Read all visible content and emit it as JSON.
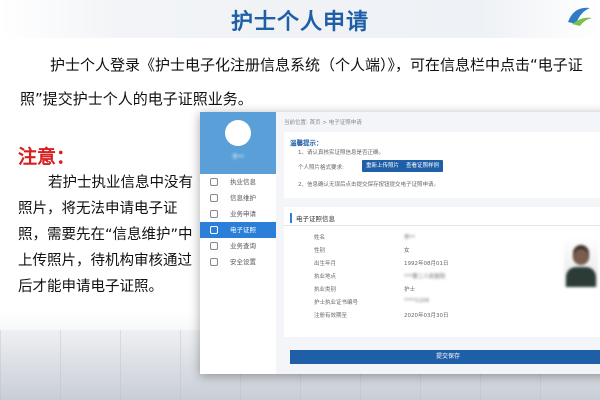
{
  "slide": {
    "title": "护士个人申请",
    "intro_line1": "护士个人登录《护士电子化注册信息系统（个人端）》，可在信息栏中点击“电子证",
    "intro_line2": "照”提交护士个人的电子证照业务。",
    "note_title": "注意：",
    "note_body": "若护士执业信息中没有照片，将无法申请电子证照，需要先在“信息维护”中上传照片，待机构审核通过后才能申请电子证照。"
  },
  "app": {
    "breadcrumb": "当前位置: 首页 > 电子证照申请",
    "username": "李**",
    "nav": [
      {
        "label": "执业信息",
        "icon": "person-icon",
        "active": false
      },
      {
        "label": "信息维护",
        "icon": "edit-icon",
        "active": false
      },
      {
        "label": "业务申请",
        "icon": "document-icon",
        "active": false
      },
      {
        "label": "电子证照",
        "icon": "certificate-icon",
        "active": true
      },
      {
        "label": "业务查询",
        "icon": "search-icon",
        "active": false
      },
      {
        "label": "安全设置",
        "icon": "lock-icon",
        "active": false
      }
    ],
    "tips": {
      "title": "温馨提示：",
      "line1": "1、请认真核实证照信息是否正确。",
      "photo_label": "个人照片格式要求:",
      "upload_button": "重新上传照片",
      "refresh_button": "查看证照样例",
      "line2": "2、信息确认无误后点击提交保存按钮提交电子证照申请。"
    },
    "certificate": {
      "header": "电子证照信息",
      "fields": [
        {
          "label": "姓名",
          "value": "李**"
        },
        {
          "label": "性别",
          "value": "女"
        },
        {
          "label": "出生年月",
          "value": "1992年08月01日"
        },
        {
          "label": "执业地点",
          "value": "***第二人民医院"
        },
        {
          "label": "执业类别",
          "value": "护士"
        },
        {
          "label": "护士执业证书编号",
          "value": "****1104"
        },
        {
          "label": "注册有效期至",
          "value": "2020年03月30日"
        }
      ]
    },
    "submit_button": "提交保存"
  }
}
